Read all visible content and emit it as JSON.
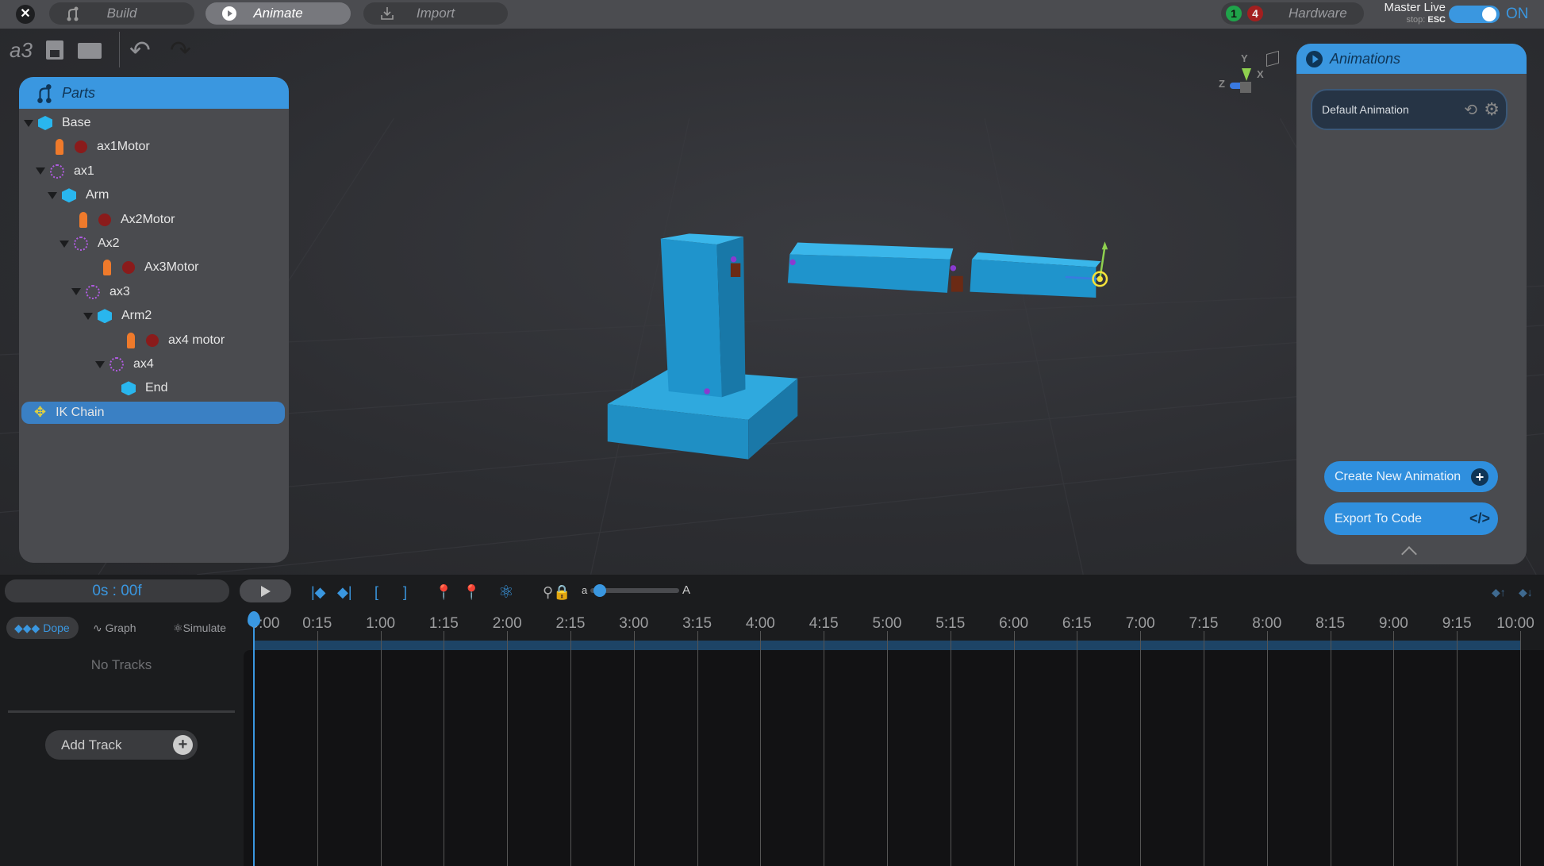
{
  "topbar": {
    "tabs": [
      {
        "label": "Build"
      },
      {
        "label": "Animate"
      },
      {
        "label": "Import"
      }
    ],
    "hardware": {
      "label": "Hardware",
      "connected_count": "1",
      "error_count": "4"
    },
    "master_live": {
      "label": "Master Live",
      "stop_hint_prefix": "stop:",
      "stop_key": "ESC",
      "toggle_state": "ON"
    }
  },
  "toolbar": {
    "project_name": "a3"
  },
  "parts": {
    "title": "Parts",
    "items": [
      {
        "label": "Base",
        "type": "body",
        "level": 0
      },
      {
        "label": "ax1Motor",
        "type": "motor",
        "level": 1
      },
      {
        "label": "ax1",
        "type": "joint",
        "level": 0
      },
      {
        "label": "Arm",
        "type": "body",
        "level": 1
      },
      {
        "label": "Ax2Motor",
        "type": "motor",
        "level": 2
      },
      {
        "label": "Ax2",
        "type": "joint",
        "level": 1
      },
      {
        "label": "Ax3Motor",
        "type": "motor",
        "level": 3
      },
      {
        "label": "ax3",
        "type": "joint",
        "level": 2
      },
      {
        "label": "Arm2",
        "type": "body",
        "level": 3
      },
      {
        "label": "ax4 motor",
        "type": "motor",
        "level": 4
      },
      {
        "label": "ax4",
        "type": "joint",
        "level": 3
      },
      {
        "label": "End",
        "type": "body",
        "level": 4
      },
      {
        "label": "IK Chain",
        "type": "ik",
        "level": 0,
        "selected": true
      }
    ]
  },
  "gizmo": {
    "y": "Y",
    "x": "X",
    "z": "Z"
  },
  "animations": {
    "title": "Animations",
    "items": [
      {
        "label": "Default Animation"
      }
    ],
    "create_label": "Create New Animation",
    "export_label": "Export To Code"
  },
  "timeline": {
    "time": "0s : 00f",
    "slider_min_label": "a",
    "slider_max_label": "A",
    "slider_value": 0.05,
    "modes": [
      {
        "label": "Dope",
        "active": true
      },
      {
        "label": "Graph"
      },
      {
        "label": "Simulate"
      }
    ],
    "ticks": [
      "0:00",
      "0:15",
      "1:00",
      "1:15",
      "2:00",
      "2:15",
      "3:00",
      "3:15",
      "4:00",
      "4:15",
      "5:00",
      "5:15",
      "6:00",
      "6:15",
      "7:00",
      "7:15",
      "8:00",
      "8:15",
      "9:00",
      "9:15",
      "10:00"
    ],
    "empty_label": "No Tracks",
    "add_track_label": "Add Track"
  },
  "colors": {
    "accent": "#3a97e0",
    "part": "#29b6ee",
    "ok": "#1fa34a",
    "error": "#a31f1f"
  }
}
